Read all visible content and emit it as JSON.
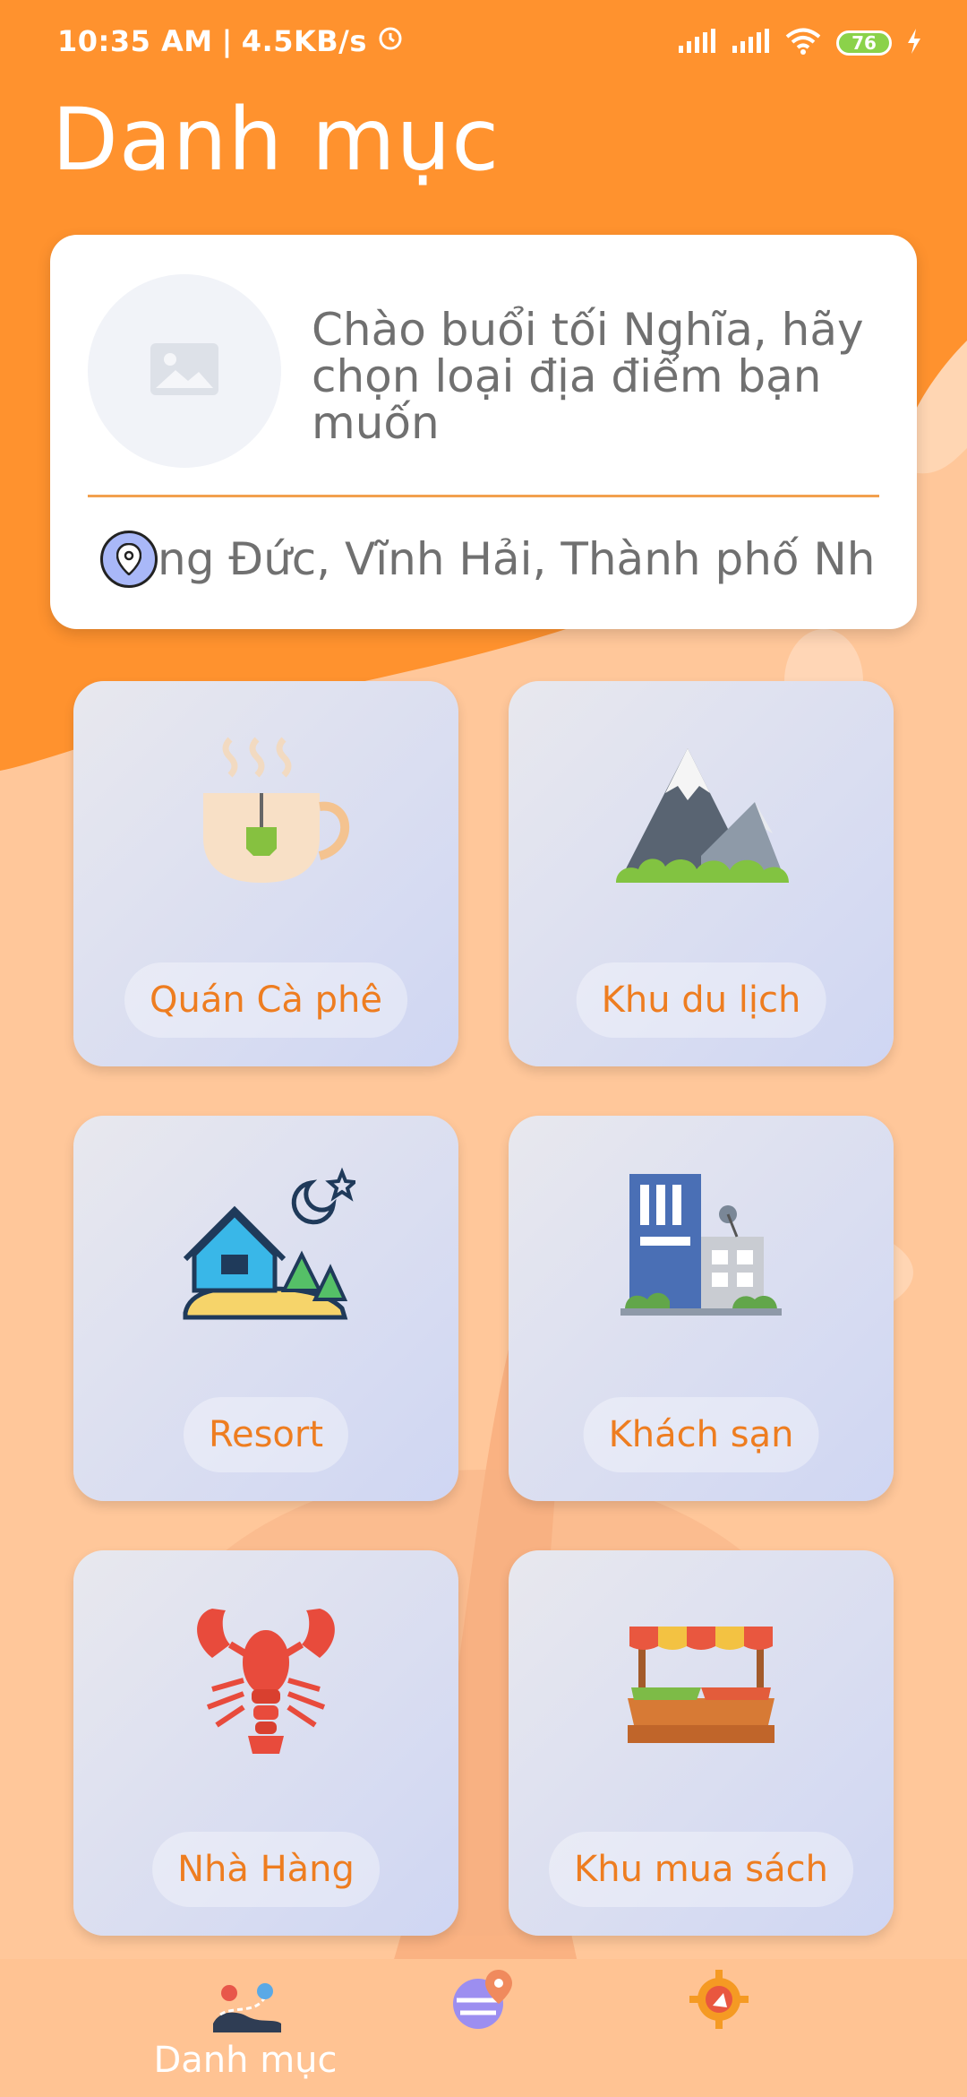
{
  "status_bar": {
    "time": "10:35 AM",
    "separator": "|",
    "speed": "4.5KB/s",
    "battery": "76"
  },
  "header": {
    "title": "Danh mục"
  },
  "greeting_card": {
    "text": "Chào buổi tối Nghĩa, hãy chọn loại địa điểm bạn muốn",
    "location": "ng Đức, Vĩnh Hải, Thành phố Nh"
  },
  "categories": [
    {
      "label": "Quán Cà phê",
      "icon": "coffee-cup-icon"
    },
    {
      "label": "Khu du lịch",
      "icon": "mountain-icon"
    },
    {
      "label": "Resort",
      "icon": "resort-house-icon"
    },
    {
      "label": "Khách sạn",
      "icon": "hotel-building-icon"
    },
    {
      "label": "Nhà Hàng",
      "icon": "lobster-icon"
    },
    {
      "label": "Khu mua sách",
      "icon": "market-stall-icon"
    }
  ],
  "bottom_nav": {
    "items": [
      {
        "label": "Danh mục",
        "icon": "route-map-icon"
      },
      {
        "label": "",
        "icon": "map-pin-icon"
      },
      {
        "label": "",
        "icon": "gear-compass-icon"
      }
    ]
  },
  "colors": {
    "primary_orange": "#ff922e",
    "label_orange": "#ee7d20",
    "divider": "#f2a04e",
    "battery_green": "#8bd24a"
  }
}
